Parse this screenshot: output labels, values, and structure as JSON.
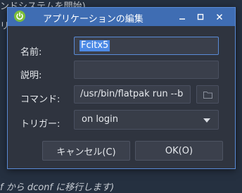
{
  "background": {
    "top_text": "ンドシステムを開始)",
    "left_text": "リ",
    "bottom_text": "f から dconf に移行します)"
  },
  "dialog": {
    "title": "アプリケーションの編集",
    "icons": {
      "app": "power-icon",
      "minimize": "minimize-icon",
      "maximize": "maximize-icon",
      "close": "close-icon",
      "browse": "folder-icon",
      "dropdown": "chevron-down-icon"
    },
    "accent_color": "#3f6db3",
    "fields": {
      "name_label": "名前:",
      "name_value": "Fcitx5",
      "description_label": "説明:",
      "description_value": "",
      "command_label": "コマンド:",
      "command_value": "/usr/bin/flatpak run --b",
      "trigger_label": "トリガー:",
      "trigger_value": "on login"
    },
    "buttons": {
      "cancel": "キャンセル(C)",
      "ok": "OK(O)"
    }
  }
}
